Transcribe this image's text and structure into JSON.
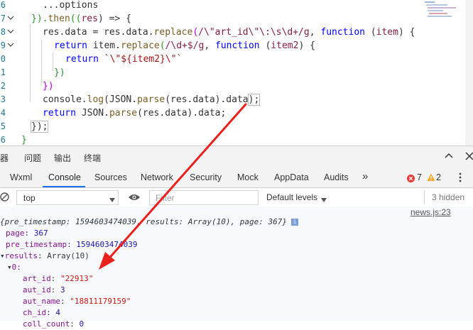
{
  "editor": {
    "line_numbers": [
      "6",
      "7",
      "8",
      "9",
      "0",
      "1",
      "2",
      "3",
      "4",
      "5",
      "6"
    ],
    "lines": {
      "l0": "...options",
      "l1a": "}).",
      "l1b": "then",
      "l1c": "((",
      "l1d": "res",
      "l1e": ") => {",
      "l2a": "res.data = res.data.",
      "l2b": "replace",
      "l2c": "(",
      "l2d": "/\\\"art_id\\\"\\:\\s\\d+/g",
      "l2e": ", ",
      "l2f": "function",
      "l2g": " (",
      "l2h": "item",
      "l2i": ") {",
      "l3a": "return",
      "l3b": " item.",
      "l3c": "replace",
      "l3d": "(",
      "l3e": "/\\d+$/g",
      "l3f": ", ",
      "l3g": "function",
      "l3h": " (",
      "l3i": "item2",
      "l3j": ") {",
      "l4a": "return",
      "l4b": " `\\\"${item2}\\\"`",
      "l5": "})",
      "l6": "})",
      "l7a": "console.",
      "l7b": "log",
      "l7c": "(JSON.",
      "l7d": "parse",
      "l7e": "(res.data).data",
      "l7f": ");",
      "l8a": "return",
      "l8b": " JSON.",
      "l8c": "parse",
      "l8d": "(res.data).data;",
      "l9": "});",
      "l10": "}"
    }
  },
  "devtools": {
    "drawer_tabs": [
      "器",
      "问题",
      "输出",
      "终端"
    ],
    "main_tabs": [
      "Wxml",
      "Console",
      "Sources",
      "Network",
      "Security",
      "Mock",
      "AppData",
      "Audits"
    ],
    "more_tabs": "»",
    "errors": "7",
    "warnings": "2",
    "context": "top",
    "filter_placeholder": "Filter",
    "levels": "Default levels",
    "hidden": "3 hidden",
    "source_link": "news.js:23",
    "summary": "{pre_timestamp: 1594603474039, results: Array(10), page: 367}",
    "rows": {
      "page_key": "page",
      "page_val": "367",
      "pre_key": "pre_timestamp",
      "pre_val": "1594603474039",
      "results_key": "results",
      "results_val": "Array(10)",
      "idx0": "0:",
      "art_id_key": "art_id",
      "art_id_val": "\"22913\"",
      "aut_id_key": "aut_id",
      "aut_id_val": "3",
      "aut_name_key": "aut_name",
      "aut_name_val": "\"18811179159\"",
      "ch_id_key": "ch_id",
      "ch_id_val": "4",
      "partial_key": "coll_count",
      "partial_val": "0"
    }
  },
  "colors": {
    "arrow": "#e8211d",
    "accent": "#1a73e8",
    "error": "#e53935",
    "warning": "#f9a825"
  }
}
